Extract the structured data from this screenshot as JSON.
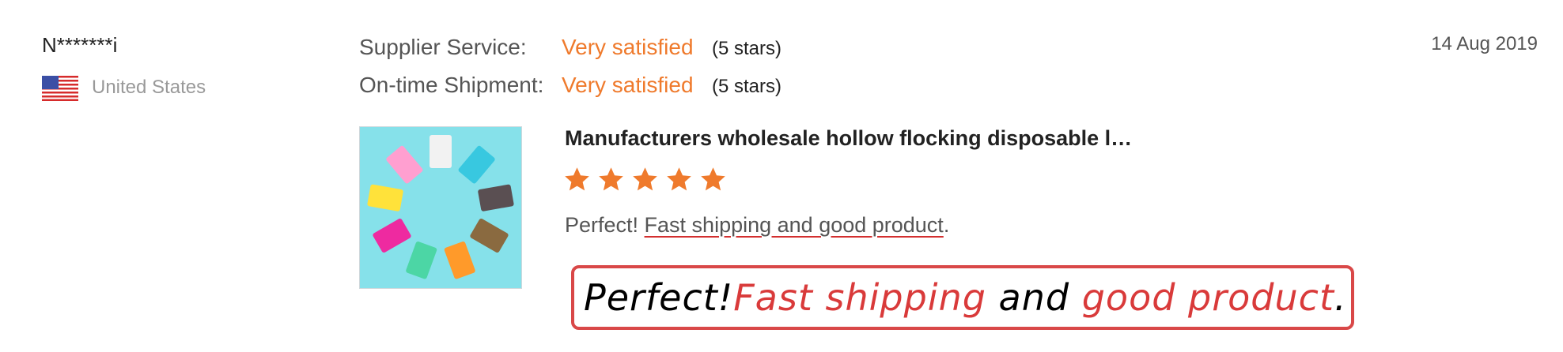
{
  "reviewer": {
    "name": "N*******i",
    "country": "United States",
    "flag_icon": "us-flag-icon"
  },
  "ratings": [
    {
      "label": "Supplier Service:",
      "value": "Very satisfied",
      "stars": "(5 stars)"
    },
    {
      "label": "On-time Shipment:",
      "value": "Very satisfied",
      "stars": "(5 stars)"
    }
  ],
  "date": "14 Aug 2019",
  "product": {
    "title": "Manufacturers wholesale hollow flocking disposable l…",
    "rating": 5,
    "star_icon": "star-icon",
    "star_color": "#ef7a2c"
  },
  "comment": {
    "lead": "Perfect! ",
    "underlined": "Fast shipping and good product",
    "end": "."
  },
  "callout": {
    "w1": "Perfect! ",
    "w2": "Fast shipping",
    "w3": " and ",
    "w4": "good product",
    "w5": "."
  },
  "colors": {
    "accent": "#ef7a2c",
    "highlight": "#d93a3a"
  }
}
